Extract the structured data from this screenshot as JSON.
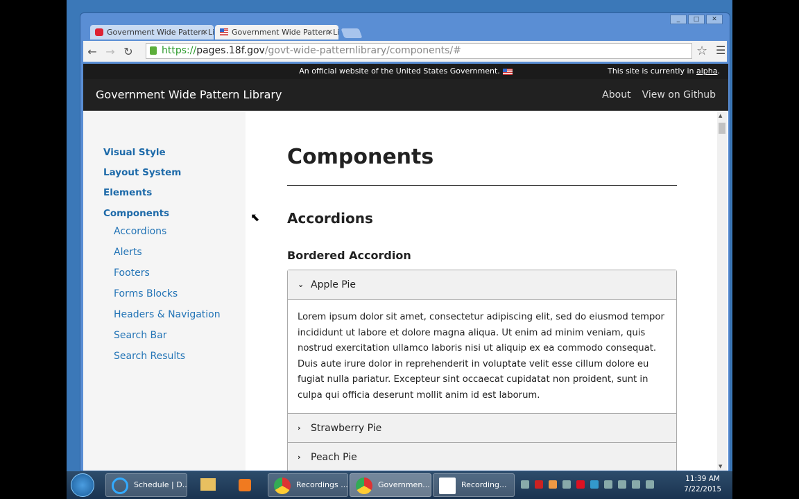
{
  "browser": {
    "tabs": [
      {
        "title": "Government Wide Pattern Library",
        "active": false
      },
      {
        "title": "Government Wide Pattern Library",
        "active": true
      }
    ],
    "url": {
      "scheme": "https://",
      "host": "pages.18f.gov",
      "path": "/govt-wide-patternlibrary/components/#"
    }
  },
  "banner": {
    "official": "An official website of the United States Government.",
    "status_prefix": "This site is currently in ",
    "status_link": "alpha",
    "status_suffix": "."
  },
  "header": {
    "title": "Government Wide Pattern Library",
    "links": [
      "About",
      "View on Github"
    ]
  },
  "sidebar": {
    "items": [
      "Visual Style",
      "Layout System",
      "Elements",
      "Components"
    ],
    "subitems": [
      "Accordions",
      "Alerts",
      "Footers",
      "Forms Blocks",
      "Headers & Navigation",
      "Search Bar",
      "Search Results"
    ]
  },
  "main": {
    "title": "Components",
    "section": "Accordions",
    "subsection": "Bordered Accordion",
    "accordion": [
      {
        "label": "Apple Pie",
        "expanded": true,
        "body": "Lorem ipsum dolor sit amet, consectetur adipiscing elit, sed do eiusmod tempor incididunt ut labore et dolore magna aliqua. Ut enim ad minim veniam, quis nostrud exercitation ullamco laboris nisi ut aliquip ex ea commodo consequat. Duis aute irure dolor in reprehenderit in voluptate velit esse cillum dolore eu fugiat nulla pariatur. Excepteur sint occaecat cupidatat non proident, sunt in culpa qui officia deserunt mollit anim id est laborum."
      },
      {
        "label": "Strawberry Pie",
        "expanded": false
      },
      {
        "label": "Peach Pie",
        "expanded": false
      }
    ]
  },
  "taskbar": {
    "items": [
      "Schedule | D...",
      "Recordings ...",
      "Governmen...",
      "Recording..."
    ],
    "time": "11:39 AM",
    "date": "7/22/2015"
  }
}
